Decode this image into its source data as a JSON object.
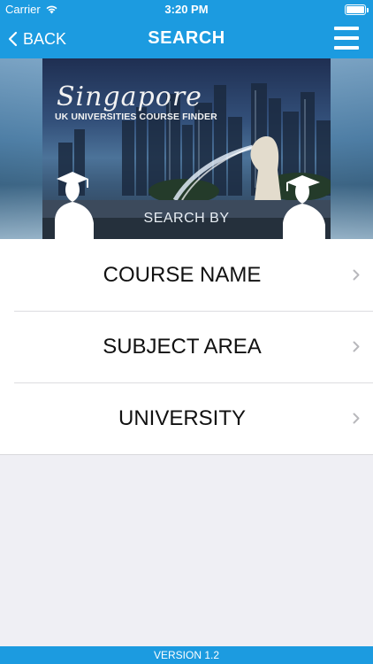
{
  "status_bar": {
    "carrier": "Carrier",
    "time": "3:20 PM",
    "battery_level": 1.0
  },
  "nav": {
    "back_label": "BACK",
    "title": "SEARCH",
    "menu_icon": "hamburger-menu-icon",
    "back_icon": "chevron-left-icon"
  },
  "banner": {
    "script_title": "Singapore",
    "subtitle": "UK UNIVERSITIES COURSE FINDER",
    "search_by": "SEARCH BY"
  },
  "options": [
    {
      "label": "COURSE NAME"
    },
    {
      "label": "SUBJECT AREA"
    },
    {
      "label": "UNIVERSITY"
    }
  ],
  "footer": {
    "version": "VERSION 1.2"
  },
  "colors": {
    "accent": "#1c9be0",
    "background": "#efeff4",
    "list_background": "#ffffff",
    "text": "#111111",
    "chevron": "#b8b8bc"
  }
}
